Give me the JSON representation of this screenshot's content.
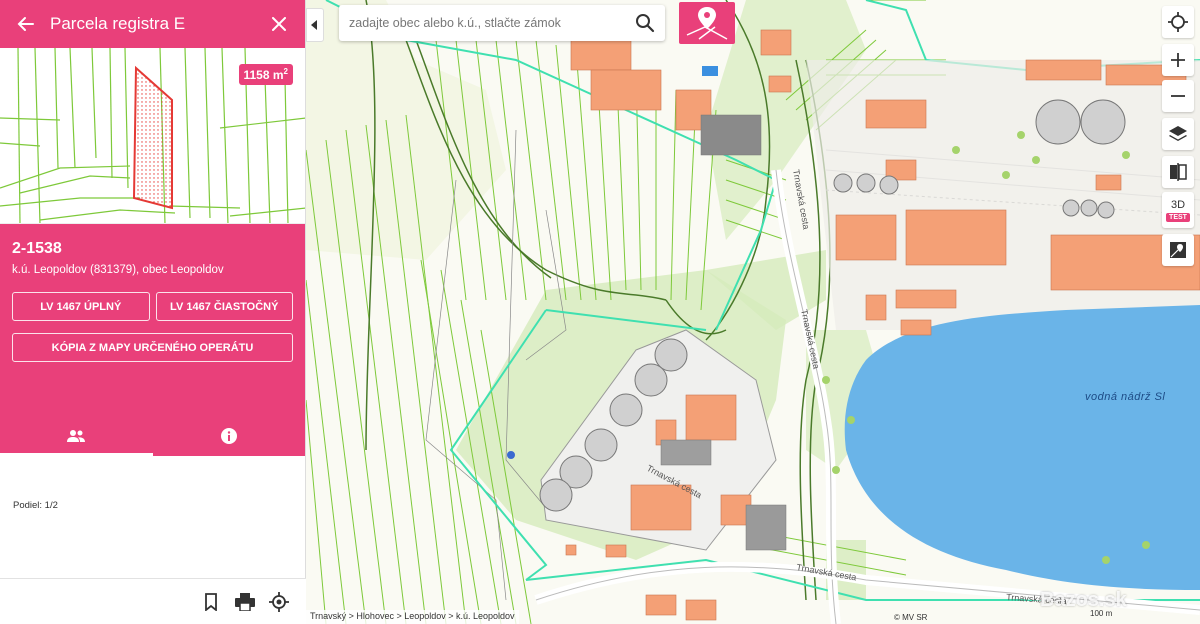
{
  "panel": {
    "title": "Parcela registra E",
    "area_value": "1158 m",
    "area_unit_exp": "2",
    "parcel_number": "2-1538",
    "parcel_sub": "k.ú. Leopoldov (831379), obec Leopoldov",
    "btn_lv_full": "LV 1467 ÚPLNÝ",
    "btn_lv_partial": "LV 1467 ČIASTOČNÝ",
    "btn_copy": "KÓPIA Z MAPY URČENÉHO OPERÁTU",
    "podiel": "Podiel: 1/2"
  },
  "search": {
    "placeholder": "zadajte obec alebo k.ú., stlačte zámok"
  },
  "map": {
    "lake_label": "vodná nádrž Sl",
    "road_label_1": "Trnavská cesta",
    "road_label_2": "Trnavská cesta",
    "road_label_3": "Trnavská cesta",
    "road_label_4": "Trnavská cesta",
    "road_label_5": "Trnavská cesta",
    "breadcrumb": "Trnavský > Hlohovec > Leopoldov > k.ú. Leopoldov",
    "copyright": "© MV SR",
    "scale": "100 m",
    "watermark": "Bazos.sk"
  },
  "controls": {
    "three_d": "3D",
    "test": "TEST"
  },
  "colors": {
    "accent": "#e9407a",
    "parcel_outline": "#e53935",
    "cadastre_lines": "#7ec93a",
    "highlight": "#3fe0b0",
    "building": "#f4a076",
    "lake": "#6ab4e8",
    "vegetation": "#d6ebbc"
  }
}
